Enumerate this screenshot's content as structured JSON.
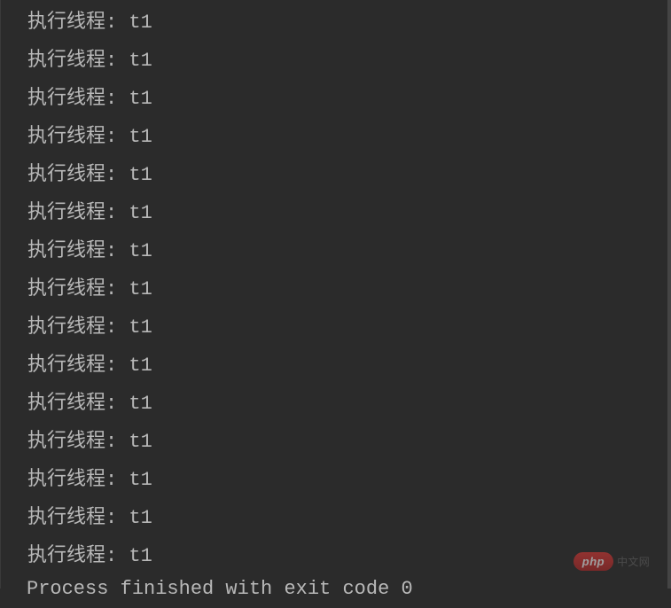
{
  "console": {
    "lines": [
      "执行线程: t1",
      "执行线程: t1",
      "执行线程: t1",
      "执行线程: t1",
      "执行线程: t1",
      "执行线程: t1",
      "执行线程: t1",
      "执行线程: t1",
      "执行线程: t1",
      "执行线程: t1",
      "执行线程: t1",
      "执行线程: t1",
      "执行线程: t1",
      "执行线程: t1",
      "执行线程: t1"
    ],
    "process_message": "Process finished with exit code 0"
  },
  "watermark": {
    "badge": "php",
    "text": "中文网"
  }
}
